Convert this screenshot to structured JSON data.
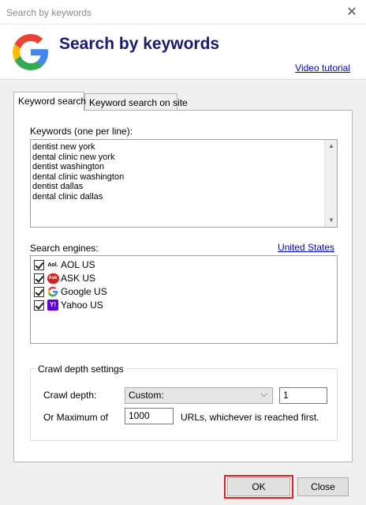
{
  "window": {
    "title": "Search by keywords",
    "close_glyph": "✕"
  },
  "header": {
    "title": "Search by keywords",
    "video_link": "Video tutorial"
  },
  "tabs": [
    {
      "label": "Keyword search",
      "active": true
    },
    {
      "label": "Keyword search on site",
      "active": false
    }
  ],
  "keywords": {
    "label": "Keywords (one per line):",
    "lines": [
      "dentist new york",
      "dental clinic new york",
      "dentist washington",
      "dental clinic washington",
      "dentist dallas",
      "dental clinic dallas"
    ]
  },
  "engines": {
    "label": "Search engines:",
    "country_link": "United States",
    "items": [
      {
        "label": "AOL US",
        "checked": true,
        "icon": "aol-icon",
        "icon_text": "Aol."
      },
      {
        "label": "ASK US",
        "checked": true,
        "icon": "ask-icon",
        "icon_text": "Ask"
      },
      {
        "label": "Google US",
        "checked": true,
        "icon": "google-icon",
        "icon_text": "G"
      },
      {
        "label": "Yahoo US",
        "checked": true,
        "icon": "yahoo-icon",
        "icon_text": "Y!"
      }
    ]
  },
  "crawl": {
    "group_title": "Crawl depth settings",
    "depth_label": "Crawl depth:",
    "depth_select": "Custom:",
    "depth_value": "1",
    "max_label": "Or Maximum of",
    "max_value": "1000",
    "max_suffix": "URLs, whichever is reached first."
  },
  "buttons": {
    "ok": "OK",
    "close": "Close"
  },
  "colors": {
    "header_title": "#1a1a6e",
    "link": "#0000cc",
    "highlight": "#e02020"
  }
}
